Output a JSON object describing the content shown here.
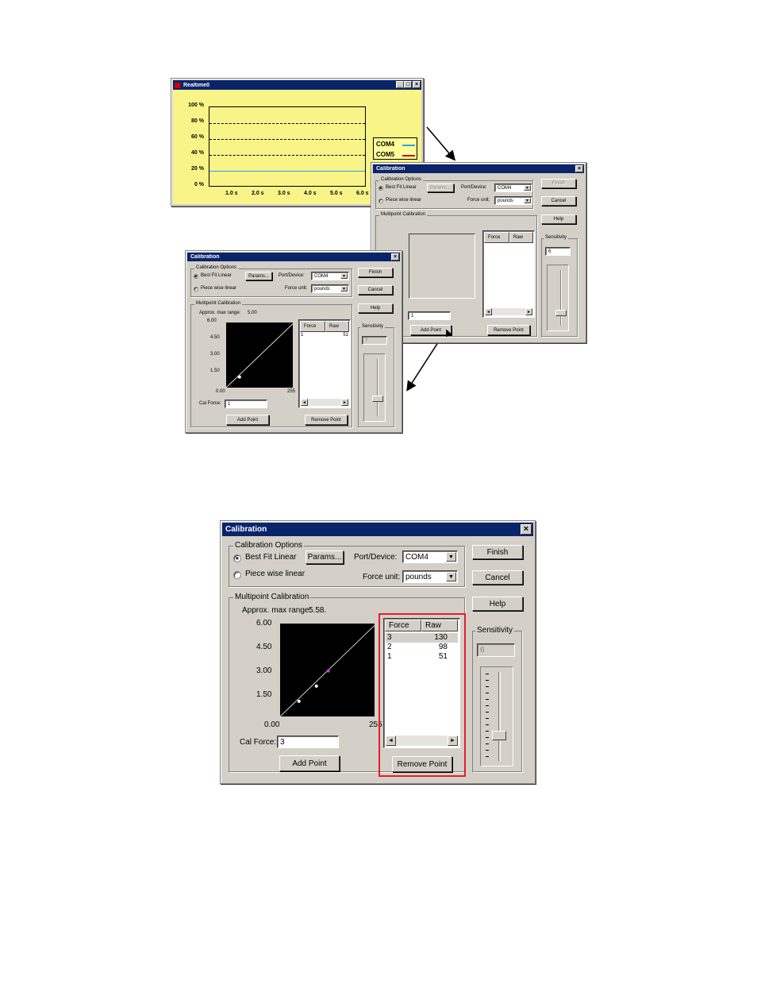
{
  "realtime_window": {
    "title": "Realtime0",
    "y_ticks": [
      "100 %",
      "80 %",
      "60 %",
      "40 %",
      "20 %",
      "0 %"
    ],
    "x_ticks": [
      "1.0 s",
      "2.0 s",
      "3.0 s",
      "4.0 s",
      "5.0 s",
      "6.0 s"
    ],
    "legend": [
      {
        "name": "COM4",
        "color": "#2a9df4"
      },
      {
        "name": "COM5",
        "color": "#d0021b"
      }
    ],
    "background": "#f8f488"
  },
  "cal_a": {
    "title": "Calibration",
    "options_label": "Calibration Options",
    "best_fit": "Best Fit Linear",
    "params": "Params...",
    "piece_wise": "Piece wise linear",
    "port_label": "Port/Device:",
    "port_value": "COM4",
    "unit_label": "Force unit:",
    "unit_value": "pounds",
    "finish": "Finish",
    "cancel": "Cancel",
    "help": "Help",
    "multipoint_label": "Multipoint Calibration",
    "col_force": "Force",
    "col_raw": "Raw",
    "cal_value": "1",
    "add_point": "Add Point",
    "remove_point": "Remove Point",
    "sensitivity_label": "Sensitivity",
    "sensitivity_value": "6"
  },
  "cal_b": {
    "title": "Calibration",
    "options_label": "Calibration Options",
    "best_fit": "Best Fit Linear",
    "params": "Params...",
    "piece_wise": "Piece wise linear",
    "port_label": "Port/Device:",
    "port_value": "COM4",
    "unit_label": "Force unit:",
    "unit_value": "pounds",
    "finish": "Finish",
    "cancel": "Cancel",
    "help": "Help",
    "multipoint_label": "Multipoint Calibration",
    "range_label": "Approx. max range:",
    "range_value": "5.00",
    "y_ticks": [
      "6.00",
      "4.50",
      "3.00",
      "1.50"
    ],
    "x_min": "0.00",
    "x_max": "255",
    "col_force": "Force",
    "col_raw": "Raw",
    "rows": [
      {
        "force": "1",
        "raw": "51"
      }
    ],
    "cal_force_label": "Cal Force:",
    "cal_value": "1",
    "add_point": "Add Point",
    "remove_point": "Remove Point",
    "sensitivity_label": "Sensitivity",
    "sensitivity_value": "7"
  },
  "cal_c": {
    "title": "Calibration",
    "options_label": "Calibration Options",
    "best_fit": "Best Fit Linear",
    "params": "Params...",
    "piece_wise": "Piece wise linear",
    "port_label": "Port/Device:",
    "port_value": "COM4",
    "unit_label": "Force unit:",
    "unit_value": "pounds",
    "finish": "Finish",
    "cancel": "Cancel",
    "help": "Help",
    "multipoint_label": "Multipoint Calibration",
    "range_label": "Approx. max range:",
    "range_value": "5.58.",
    "y_ticks": [
      "6.00",
      "4.50",
      "3.00",
      "1.50"
    ],
    "x_min": "0.00",
    "x_max": "255",
    "col_force": "Force",
    "col_raw": "Raw",
    "rows": [
      {
        "force": "3",
        "raw": "130"
      },
      {
        "force": "2",
        "raw": "98"
      },
      {
        "force": "1",
        "raw": "51"
      }
    ],
    "cal_force_label": "Cal Force:",
    "cal_value": "3",
    "add_point": "Add Point",
    "remove_point": "Remove Point",
    "sensitivity_label": "Sensitivity",
    "sensitivity_value": "6",
    "highlight_color": "#e0202a"
  }
}
